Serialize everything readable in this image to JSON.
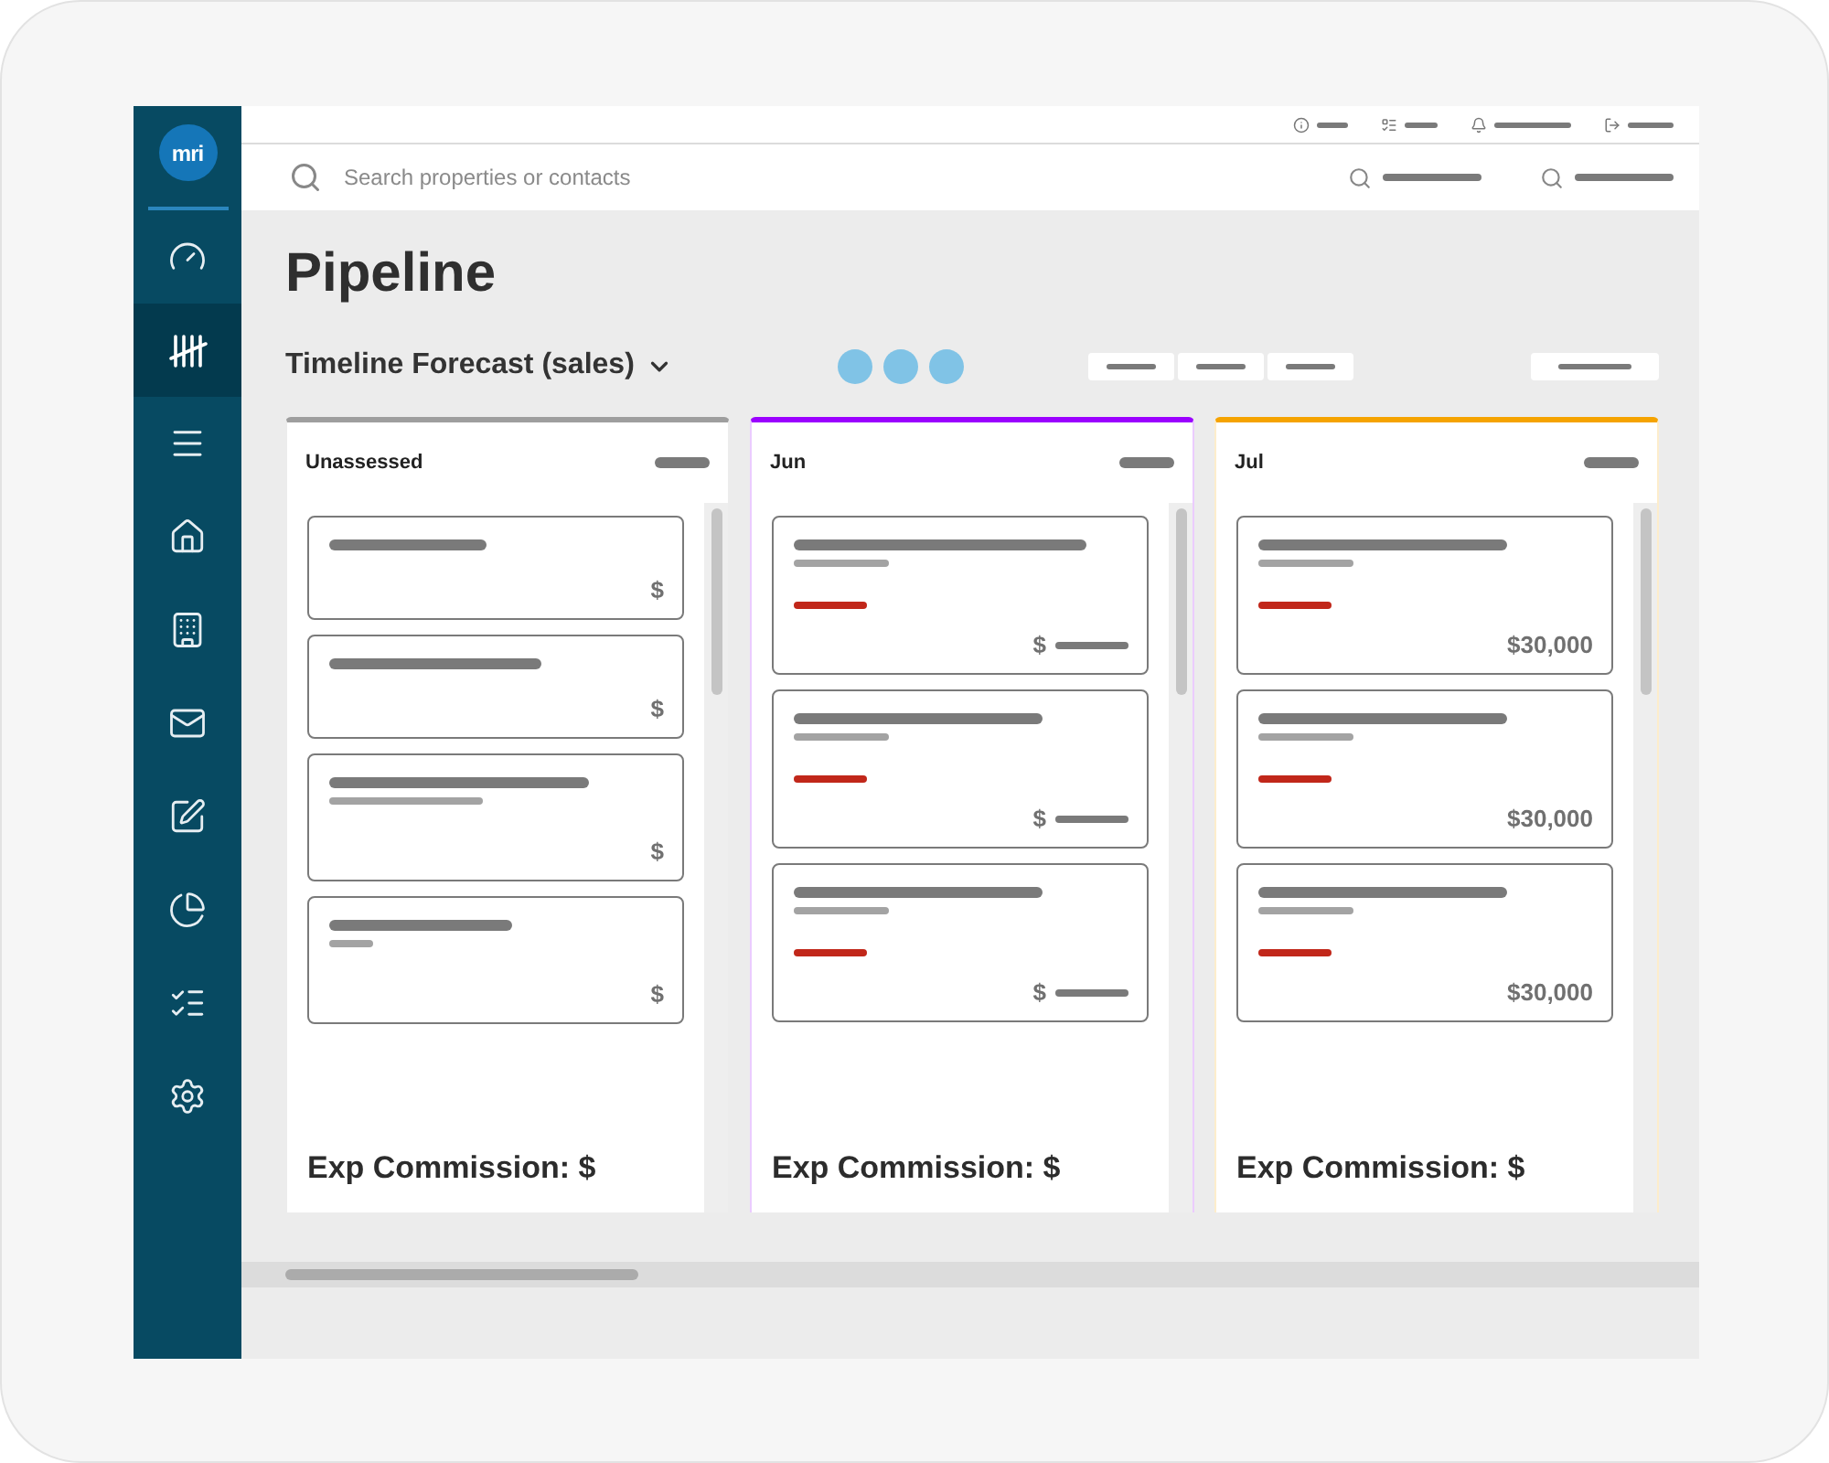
{
  "logo": "mri",
  "sidebar": {
    "items": [
      {
        "selected": false
      },
      {
        "selected": true
      },
      {
        "selected": false
      },
      {
        "selected": false
      },
      {
        "selected": false
      },
      {
        "selected": false
      },
      {
        "selected": false
      },
      {
        "selected": false
      },
      {
        "selected": false
      },
      {
        "selected": false
      }
    ]
  },
  "search": {
    "placeholder": "Search properties or contacts"
  },
  "title": "Pipeline",
  "view_selector": "Timeline Forecast (sales)",
  "columns": [
    {
      "name": "Unassessed",
      "color": "#9e9e9e",
      "footer": "Exp Commission: $",
      "cards": [
        {
          "kind": "basic",
          "amount": "$"
        },
        {
          "kind": "basic",
          "amount": "$"
        },
        {
          "kind": "detailed",
          "amount": "$"
        },
        {
          "kind": "detailed",
          "amount": "$"
        }
      ]
    },
    {
      "name": "Jun",
      "color": "#9b00ff",
      "footer": "Exp Commission: $",
      "cards": [
        {
          "kind": "pending",
          "amount": "$"
        },
        {
          "kind": "pending",
          "amount": "$"
        },
        {
          "kind": "pending",
          "amount": "$"
        }
      ]
    },
    {
      "name": "Jul",
      "color": "#f5a300",
      "footer": "Exp Commission: $",
      "cards": [
        {
          "kind": "forecast",
          "amount": "$30,000"
        },
        {
          "kind": "forecast",
          "amount": "$30,000"
        },
        {
          "kind": "forecast",
          "amount": "$30,000"
        }
      ]
    }
  ]
}
